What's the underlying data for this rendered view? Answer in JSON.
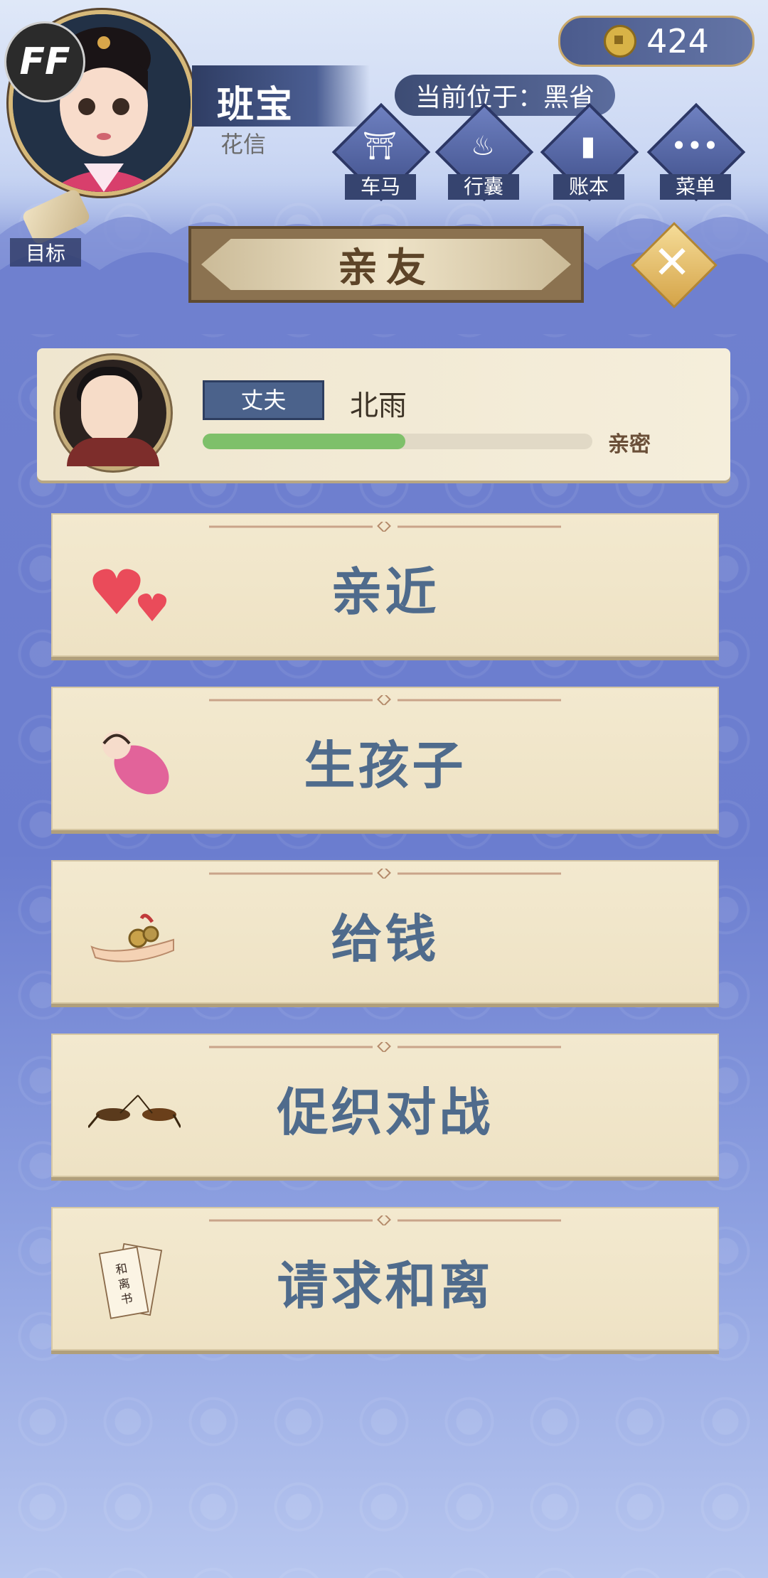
{
  "player": {
    "name": "班宝",
    "subtitle": "花信",
    "ff_badge": "FF"
  },
  "location": "当前位于：黑省",
  "coins": "424",
  "menu": [
    {
      "label": "车马",
      "icon": "carriage-icon"
    },
    {
      "label": "行囊",
      "icon": "bag-icon"
    },
    {
      "label": "账本",
      "icon": "ledger-icon"
    },
    {
      "label": "菜单",
      "icon": "more-icon"
    }
  ],
  "goal_label": "目标",
  "page_title": "亲友",
  "spouse": {
    "relation": "丈夫",
    "name": "北雨",
    "intimacy_label": "亲密",
    "intimacy_fraction": 0.52
  },
  "actions": [
    {
      "label": "亲近",
      "icon": "hearts-icon"
    },
    {
      "label": "生孩子",
      "icon": "baby-icon"
    },
    {
      "label": "给钱",
      "icon": "coins-hand-icon"
    },
    {
      "label": "促织对战",
      "icon": "crickets-icon"
    },
    {
      "label": "请求和离",
      "icon": "divorce-letter-icon"
    }
  ],
  "colors": {
    "accent_blue": "#4f6b8c",
    "intimacy_bar": "#7ec06a",
    "card_bg": "#f3e9cf"
  }
}
